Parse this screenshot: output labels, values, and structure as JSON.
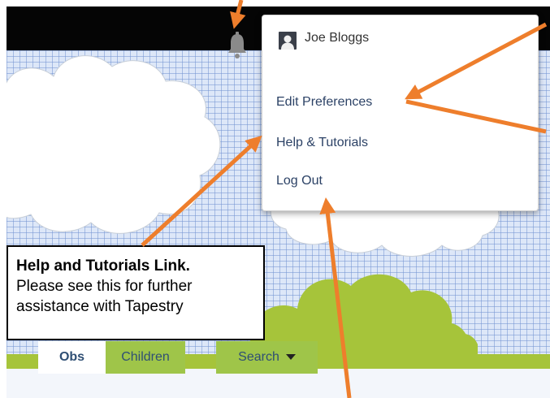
{
  "user_menu": {
    "user_name": "Joe Bloggs",
    "items": [
      "Edit Preferences",
      "Help & Tutorials",
      "Log Out"
    ]
  },
  "tabs": [
    "Obs",
    "Children",
    "Search"
  ],
  "callout": {
    "title": "Help and Tutorials Link.",
    "lines": [
      "Please see this for further",
      "assistance with Tapestry"
    ]
  },
  "colors": {
    "top_bar": "#050505",
    "annotation_arrow": "#ee7e2c",
    "tab_green": "#9fc549",
    "foliage_green": "#a6c43a",
    "menu_link": "#2c4266",
    "background_grid": "#dde7f8"
  },
  "icons": {
    "notifications": "bell-icon",
    "avatar": "user-avatar-icon",
    "search_dropdown": "caret-down-icon"
  }
}
